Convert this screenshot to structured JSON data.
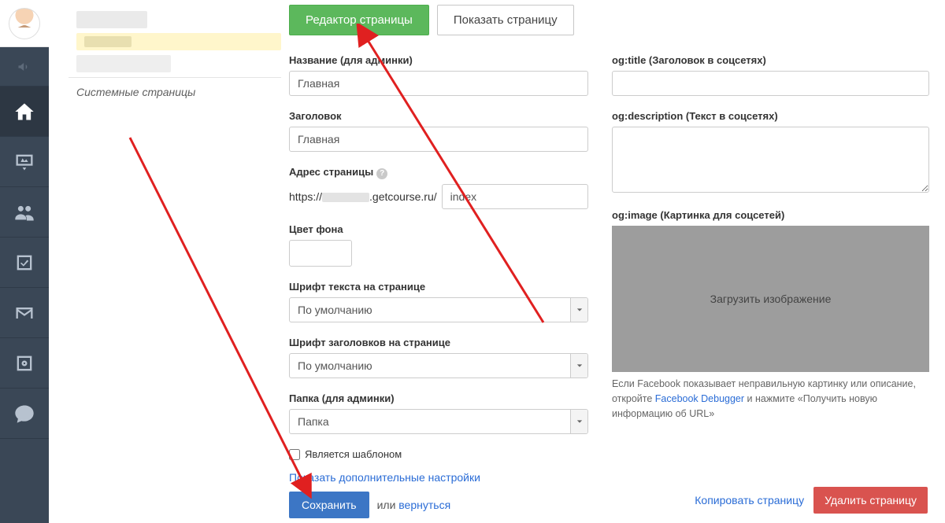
{
  "sidebar": {
    "system_pages_label": "Системные страницы"
  },
  "tabs": {
    "editor": "Редактор страницы",
    "show": "Показать страницу"
  },
  "form": {
    "title_admin_label": "Название (для админки)",
    "title_admin_value": "Главная",
    "heading_label": "Заголовок",
    "heading_value": "Главная",
    "url_label": "Адрес страницы",
    "url_prefix_left": "https://",
    "url_prefix_right": ".getcourse.ru/",
    "url_value": "index",
    "bgcolor_label": "Цвет фона",
    "font_text_label": "Шрифт текста на странице",
    "font_text_value": "По умолчанию",
    "font_heading_label": "Шрифт заголовков на странице",
    "font_heading_value": "По умолчанию",
    "folder_label": "Папка (для админки)",
    "folder_value": "Папка",
    "is_template_label": "Является шаблоном",
    "show_more_label": "Показать дополнительные настройки",
    "save_label": "Сохранить",
    "or_label": "или",
    "back_label": "вернуться"
  },
  "og": {
    "title_label": "og:title (Заголовок в соцсетях)",
    "title_value": "",
    "desc_label": "og:description (Текст в соцсетях)",
    "desc_value": "",
    "image_label": "og:image (Картинка для соцсетей)",
    "image_upload": "Загрузить изображение",
    "fb_help_1": "Если Facebook показывает неправильную картинку или описание, откройте ",
    "fb_link": "Facebook Debugger",
    "fb_help_2": " и нажмите «Получить новую информацию об URL»"
  },
  "footer": {
    "copy": "Копировать страницу",
    "delete": "Удалить страницу"
  }
}
